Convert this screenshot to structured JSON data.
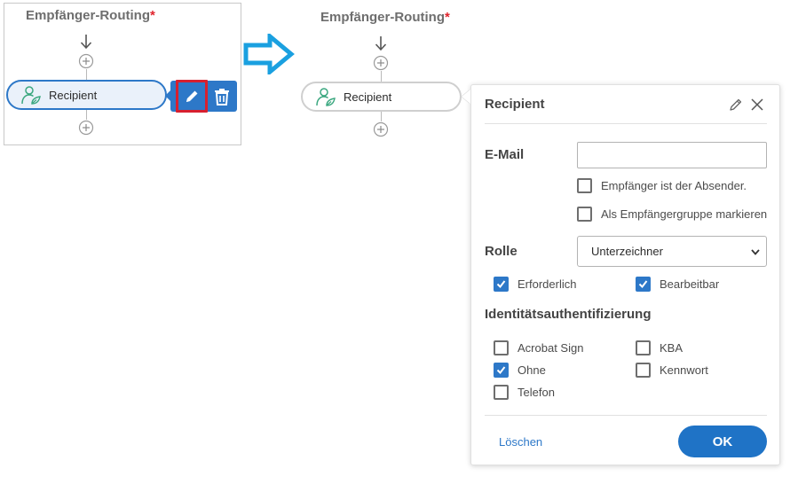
{
  "left_panel": {
    "title": "Empfänger-Routing",
    "required_mark": "*",
    "recipient_label": "Recipient"
  },
  "right_panel": {
    "title": "Empfänger-Routing",
    "required_mark": "*",
    "recipient_label": "Recipient"
  },
  "popover": {
    "title": "Recipient",
    "email": {
      "label": "E-Mail",
      "value": "",
      "placeholder": ""
    },
    "checkboxes_top": [
      {
        "label": "Empfänger ist der Absender.",
        "checked": false
      },
      {
        "label": "Als Empfängergruppe markieren",
        "checked": false
      }
    ],
    "role": {
      "label": "Rolle",
      "selected": "Unterzeichner"
    },
    "role_flags": [
      {
        "label": "Erforderlich",
        "checked": true
      },
      {
        "label": "Bearbeitbar",
        "checked": true
      }
    ],
    "auth": {
      "label": "Identitätsauthentifizierung",
      "options": [
        {
          "label": "Acrobat Sign",
          "checked": false
        },
        {
          "label": "KBA",
          "checked": false
        },
        {
          "label": "Ohne",
          "checked": true
        },
        {
          "label": "Kennwort",
          "checked": false
        },
        {
          "label": "Telefon",
          "checked": false
        }
      ]
    },
    "delete_label": "Löschen",
    "ok_label": "OK"
  },
  "colors": {
    "accent": "#2d78c8",
    "highlight": "#d7202f",
    "required": "#e0242d",
    "big_arrow": "#1aa0e0",
    "icon_green": "#3aa77f"
  }
}
